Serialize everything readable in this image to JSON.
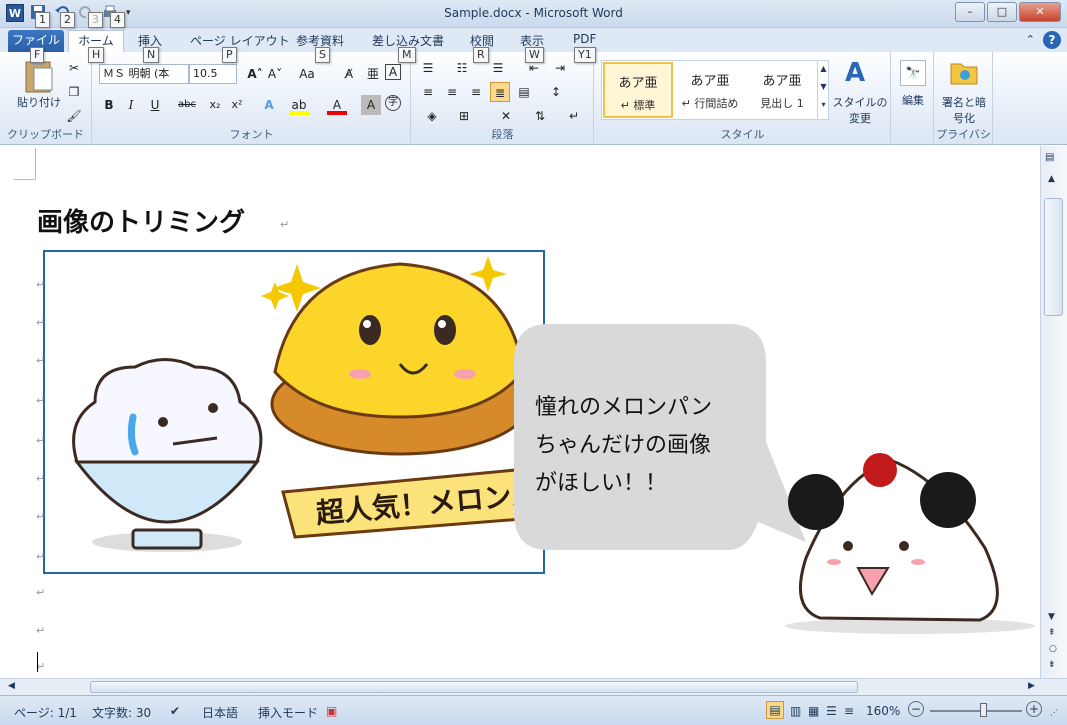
{
  "window": {
    "title": "Sample.docx  -  Microsoft Word",
    "min": "–",
    "max": "□",
    "close": "✕"
  },
  "qat": {
    "app_icon": "W",
    "keytips": [
      "1",
      "2",
      "3",
      "4"
    ],
    "file_keytip": "F"
  },
  "tabs": [
    {
      "label": "ファイル",
      "keytip": "F"
    },
    {
      "label": "ホーム",
      "keytip": "H"
    },
    {
      "label": "挿入",
      "keytip": "N"
    },
    {
      "label": "ページ レイアウト",
      "keytip": "P"
    },
    {
      "label": "参考資料",
      "keytip": "S"
    },
    {
      "label": "差し込み文書",
      "keytip": "M"
    },
    {
      "label": "校閲",
      "keytip": "R"
    },
    {
      "label": "表示",
      "keytip": "W"
    },
    {
      "label": "PDF",
      "keytip": "Y1"
    }
  ],
  "ribbon": {
    "clipboard": {
      "paste": "貼り付け",
      "label": "クリップボード"
    },
    "font": {
      "name": "ＭＳ 明朝 (本",
      "size": "10.5",
      "label": "フォント"
    },
    "paragraph": {
      "label": "段落"
    },
    "styles": {
      "label": "スタイル",
      "items": [
        {
          "preview": "あア亜",
          "name": "↵ 標準"
        },
        {
          "preview": "あア亜",
          "name": "↵ 行間詰め"
        },
        {
          "preview": "あア亜",
          "name": "見出し 1"
        }
      ],
      "change": "スタイルの\n変更"
    },
    "edit": {
      "label": "編集"
    },
    "privacy": {
      "button": "署名と暗\n号化",
      "label": "プライバシ"
    }
  },
  "document": {
    "heading": "画像のトリミング",
    "banner": "超人気！メロンパン",
    "bubble": "憧れのメロンパン\nちゃんだけの画像\nがほしい！！"
  },
  "status": {
    "page": "ページ: 1/1",
    "words": "文字数: 30",
    "lang": "日本語",
    "mode": "挿入モード",
    "zoom": "160%"
  },
  "colors": {
    "file_tab": "#2a5ea8",
    "selection_border": "#1f6aa5",
    "bubble": "#d9d9d9",
    "melonpan": "#f5c800"
  }
}
